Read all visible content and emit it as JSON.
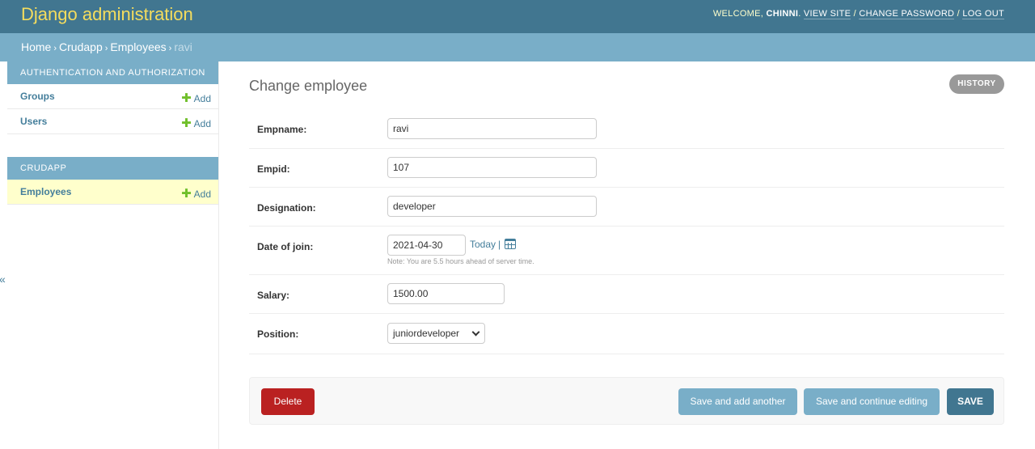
{
  "header": {
    "brand": "Django administration",
    "welcome_text": "WELCOME,",
    "username": "CHINNI",
    "view_site": "VIEW SITE",
    "change_password": "CHANGE PASSWORD",
    "log_out": "LOG OUT",
    "separator": "/"
  },
  "breadcrumbs": {
    "home": "Home",
    "app": "Crudapp",
    "model": "Employees",
    "current": "ravi",
    "separator": "›"
  },
  "sidebar": {
    "modules": [
      {
        "caption": "AUTHENTICATION AND AUTHORIZATION",
        "rows": [
          {
            "label": "Groups",
            "add": "Add"
          },
          {
            "label": "Users",
            "add": "Add"
          }
        ]
      },
      {
        "caption": "CRUDAPP",
        "rows": [
          {
            "label": "Employees",
            "add": "Add"
          }
        ]
      }
    ],
    "toggle_glyph": "«"
  },
  "content": {
    "title": "Change employee",
    "history_button": "HISTORY"
  },
  "form": {
    "empname": {
      "label": "Empname:",
      "value": "ravi"
    },
    "empid": {
      "label": "Empid:",
      "value": "107"
    },
    "designation": {
      "label": "Designation:",
      "value": "developer"
    },
    "date_of_join": {
      "label": "Date of join:",
      "value": "2021-04-30",
      "today_link": "Today",
      "link_separator": "|",
      "note": "Note: You are 5.5 hours ahead of server time."
    },
    "salary": {
      "label": "Salary:",
      "value": "1500.00"
    },
    "position": {
      "label": "Position:",
      "selected": "juniordeveloper"
    }
  },
  "actions": {
    "delete": "Delete",
    "save_add_another": "Save and add another",
    "save_continue": "Save and continue editing",
    "save": "SAVE"
  },
  "colors": {
    "header_bg": "#417690",
    "brand_text": "#f5dd5d",
    "breadcrumb_bg": "#79aec8",
    "link": "#447e9b",
    "add_icon": "#70bf2b",
    "delete_bg": "#ba2121",
    "current_row_bg": "#ffffcc"
  },
  "icons": {
    "add": "plus-icon",
    "calendar": "calendar-icon",
    "select": "chevron-down-icon"
  }
}
